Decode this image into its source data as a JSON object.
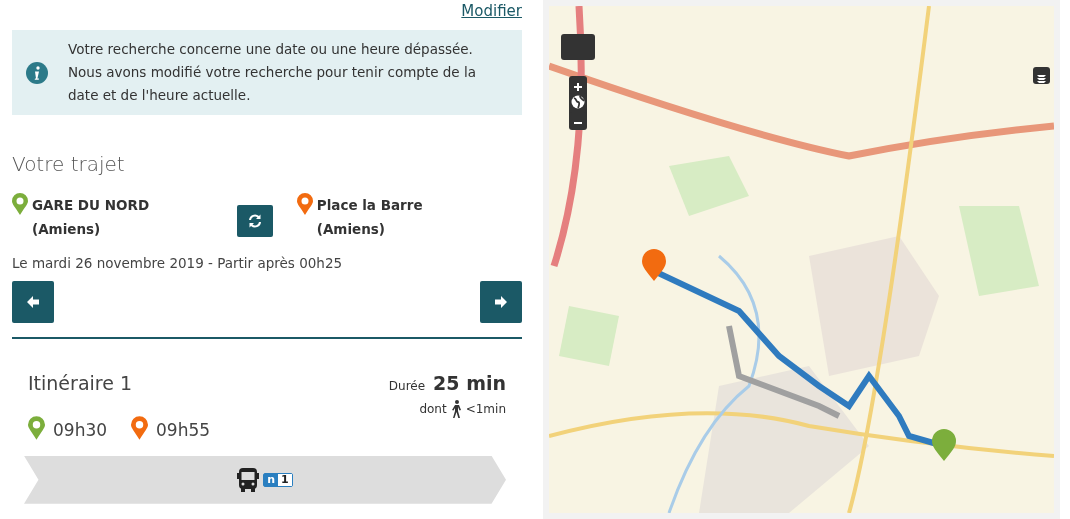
{
  "modify_link": "Modifier",
  "alert": {
    "text": "Votre recherche concerne une date ou une heure dépassée. Nous avons modifié votre recherche pour tenir compte de la date et de l'heure actuelle."
  },
  "trip": {
    "title": "Votre trajet",
    "places": [
      {
        "name": "GARE DU NORD",
        "city": "(Amiens)",
        "color": "#7cae3c"
      },
      {
        "name": "Place la Barre",
        "city": "(Amiens)",
        "color": "#f26b10"
      }
    ],
    "date": "Le mardi 26 novembre 2019 - Partir après 00h25"
  },
  "itinerary": {
    "title": "Itinéraire 1",
    "times": [
      {
        "time": "09h30",
        "color": "#7cae3c"
      },
      {
        "time": "09h55",
        "color": "#f26b10"
      }
    ],
    "duration_label": "Durée",
    "duration": "25 min",
    "walk_prefix": "dont",
    "walk": "<1min",
    "line": {
      "letter": "n",
      "number": "1"
    }
  }
}
